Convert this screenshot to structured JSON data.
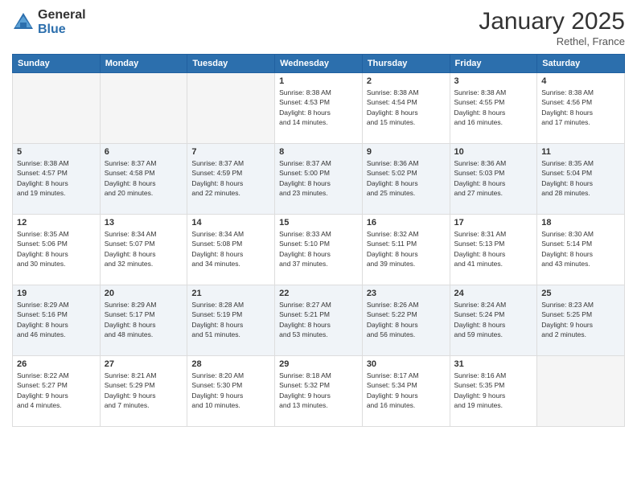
{
  "logo": {
    "general": "General",
    "blue": "Blue"
  },
  "header": {
    "month": "January 2025",
    "location": "Rethel, France"
  },
  "weekdays": [
    "Sunday",
    "Monday",
    "Tuesday",
    "Wednesday",
    "Thursday",
    "Friday",
    "Saturday"
  ],
  "weeks": [
    [
      {
        "day": "",
        "info": ""
      },
      {
        "day": "",
        "info": ""
      },
      {
        "day": "",
        "info": ""
      },
      {
        "day": "1",
        "info": "Sunrise: 8:38 AM\nSunset: 4:53 PM\nDaylight: 8 hours\nand 14 minutes."
      },
      {
        "day": "2",
        "info": "Sunrise: 8:38 AM\nSunset: 4:54 PM\nDaylight: 8 hours\nand 15 minutes."
      },
      {
        "day": "3",
        "info": "Sunrise: 8:38 AM\nSunset: 4:55 PM\nDaylight: 8 hours\nand 16 minutes."
      },
      {
        "day": "4",
        "info": "Sunrise: 8:38 AM\nSunset: 4:56 PM\nDaylight: 8 hours\nand 17 minutes."
      }
    ],
    [
      {
        "day": "5",
        "info": "Sunrise: 8:38 AM\nSunset: 4:57 PM\nDaylight: 8 hours\nand 19 minutes."
      },
      {
        "day": "6",
        "info": "Sunrise: 8:37 AM\nSunset: 4:58 PM\nDaylight: 8 hours\nand 20 minutes."
      },
      {
        "day": "7",
        "info": "Sunrise: 8:37 AM\nSunset: 4:59 PM\nDaylight: 8 hours\nand 22 minutes."
      },
      {
        "day": "8",
        "info": "Sunrise: 8:37 AM\nSunset: 5:00 PM\nDaylight: 8 hours\nand 23 minutes."
      },
      {
        "day": "9",
        "info": "Sunrise: 8:36 AM\nSunset: 5:02 PM\nDaylight: 8 hours\nand 25 minutes."
      },
      {
        "day": "10",
        "info": "Sunrise: 8:36 AM\nSunset: 5:03 PM\nDaylight: 8 hours\nand 27 minutes."
      },
      {
        "day": "11",
        "info": "Sunrise: 8:35 AM\nSunset: 5:04 PM\nDaylight: 8 hours\nand 28 minutes."
      }
    ],
    [
      {
        "day": "12",
        "info": "Sunrise: 8:35 AM\nSunset: 5:06 PM\nDaylight: 8 hours\nand 30 minutes."
      },
      {
        "day": "13",
        "info": "Sunrise: 8:34 AM\nSunset: 5:07 PM\nDaylight: 8 hours\nand 32 minutes."
      },
      {
        "day": "14",
        "info": "Sunrise: 8:34 AM\nSunset: 5:08 PM\nDaylight: 8 hours\nand 34 minutes."
      },
      {
        "day": "15",
        "info": "Sunrise: 8:33 AM\nSunset: 5:10 PM\nDaylight: 8 hours\nand 37 minutes."
      },
      {
        "day": "16",
        "info": "Sunrise: 8:32 AM\nSunset: 5:11 PM\nDaylight: 8 hours\nand 39 minutes."
      },
      {
        "day": "17",
        "info": "Sunrise: 8:31 AM\nSunset: 5:13 PM\nDaylight: 8 hours\nand 41 minutes."
      },
      {
        "day": "18",
        "info": "Sunrise: 8:30 AM\nSunset: 5:14 PM\nDaylight: 8 hours\nand 43 minutes."
      }
    ],
    [
      {
        "day": "19",
        "info": "Sunrise: 8:29 AM\nSunset: 5:16 PM\nDaylight: 8 hours\nand 46 minutes."
      },
      {
        "day": "20",
        "info": "Sunrise: 8:29 AM\nSunset: 5:17 PM\nDaylight: 8 hours\nand 48 minutes."
      },
      {
        "day": "21",
        "info": "Sunrise: 8:28 AM\nSunset: 5:19 PM\nDaylight: 8 hours\nand 51 minutes."
      },
      {
        "day": "22",
        "info": "Sunrise: 8:27 AM\nSunset: 5:21 PM\nDaylight: 8 hours\nand 53 minutes."
      },
      {
        "day": "23",
        "info": "Sunrise: 8:26 AM\nSunset: 5:22 PM\nDaylight: 8 hours\nand 56 minutes."
      },
      {
        "day": "24",
        "info": "Sunrise: 8:24 AM\nSunset: 5:24 PM\nDaylight: 8 hours\nand 59 minutes."
      },
      {
        "day": "25",
        "info": "Sunrise: 8:23 AM\nSunset: 5:25 PM\nDaylight: 9 hours\nand 2 minutes."
      }
    ],
    [
      {
        "day": "26",
        "info": "Sunrise: 8:22 AM\nSunset: 5:27 PM\nDaylight: 9 hours\nand 4 minutes."
      },
      {
        "day": "27",
        "info": "Sunrise: 8:21 AM\nSunset: 5:29 PM\nDaylight: 9 hours\nand 7 minutes."
      },
      {
        "day": "28",
        "info": "Sunrise: 8:20 AM\nSunset: 5:30 PM\nDaylight: 9 hours\nand 10 minutes."
      },
      {
        "day": "29",
        "info": "Sunrise: 8:18 AM\nSunset: 5:32 PM\nDaylight: 9 hours\nand 13 minutes."
      },
      {
        "day": "30",
        "info": "Sunrise: 8:17 AM\nSunset: 5:34 PM\nDaylight: 9 hours\nand 16 minutes."
      },
      {
        "day": "31",
        "info": "Sunrise: 8:16 AM\nSunset: 5:35 PM\nDaylight: 9 hours\nand 19 minutes."
      },
      {
        "day": "",
        "info": ""
      }
    ]
  ]
}
